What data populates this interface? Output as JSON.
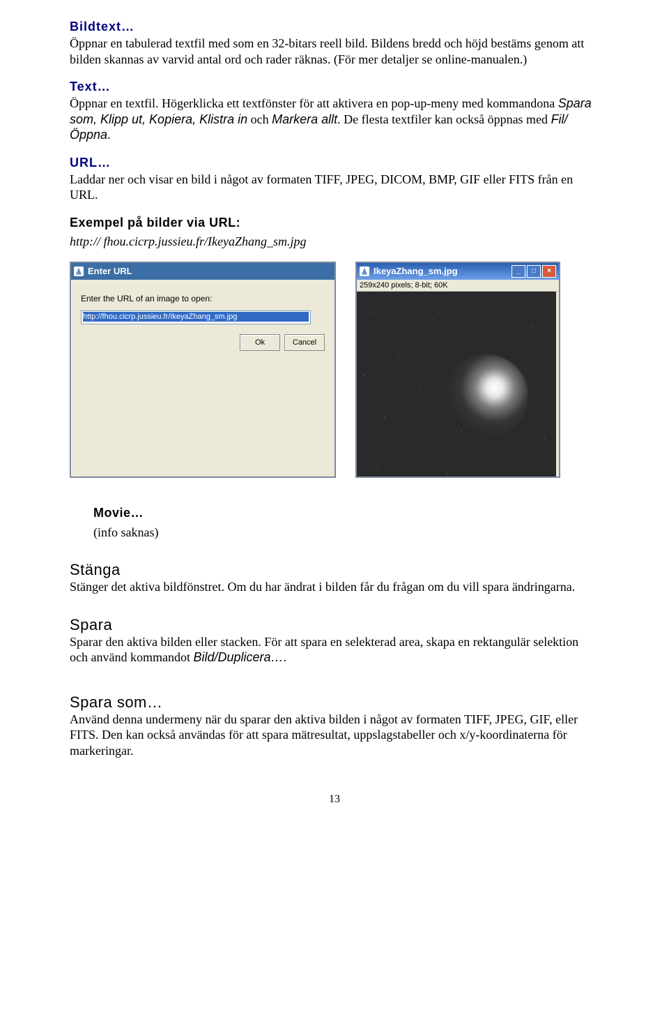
{
  "headings": {
    "bildtext": "Bildtext…",
    "text": "Text…",
    "url": "URL…",
    "exempel": "Exempel på bilder via URL:",
    "movie": "Movie…",
    "stanga": "Stänga",
    "spara": "Spara",
    "spara_som": "Spara som…"
  },
  "paragraphs": {
    "bildtext_body": "Öppnar en tabulerad textfil med som en 32-bitars reell bild. Bildens bredd och höjd bestäms genom att bilden skannas av varvid antal ord och rader räknas. (För mer detaljer se online-manualen.)",
    "text_body_1": "Öppnar en textfil. Högerklicka ett textfönster för att aktivera en pop-up-meny med kommandona ",
    "text_body_cmds": "Spara som, Klipp ut, Kopiera, Klistra in",
    "text_body_2": " och ",
    "text_body_markera": "Markera allt",
    "text_body_3": ". De flesta textfiler kan också öppnas med ",
    "text_body_filoppna": "Fil/Öppna",
    "text_body_4": ".",
    "url_body": "Laddar ner och visar en bild i något av formaten TIFF, JPEG, DICOM, BMP, GIF eller FITS från en URL.",
    "url_example": "http:// fhou.cicrp.jussieu.fr/IkeyaZhang_sm.jpg",
    "movie_body": "(info saknas)",
    "stanga_body": "Stänger det aktiva bildfönstret. Om du har ändrat i bilden får du frågan om du vill spara ändringarna.",
    "spara_body_1": "Sparar den aktiva bilden eller stacken. För att spara en selekterad area, skapa en rektangulär selektion och använd kommandot ",
    "spara_body_cmd": "Bild/Duplicera…",
    "spara_body_2": ".",
    "spara_som_body": "Använd denna undermeny när du sparar den aktiva bilden i något av formaten TIFF, JPEG, GIF, eller FITS. Den kan också användas för att spara mätresultat, uppslagstabeller och x/y-koordinaterna för markeringar."
  },
  "dialog": {
    "title": "Enter URL",
    "label": "Enter the URL of an image to open:",
    "input_value": "http://fhou.cicrp.jussieu.fr/IkeyaZhang_sm.jpg",
    "ok": "Ok",
    "cancel": "Cancel"
  },
  "image_window": {
    "title": "IkeyaZhang_sm.jpg",
    "status": "259x240 pixels; 8-bit; 60K"
  },
  "page_number": "13"
}
